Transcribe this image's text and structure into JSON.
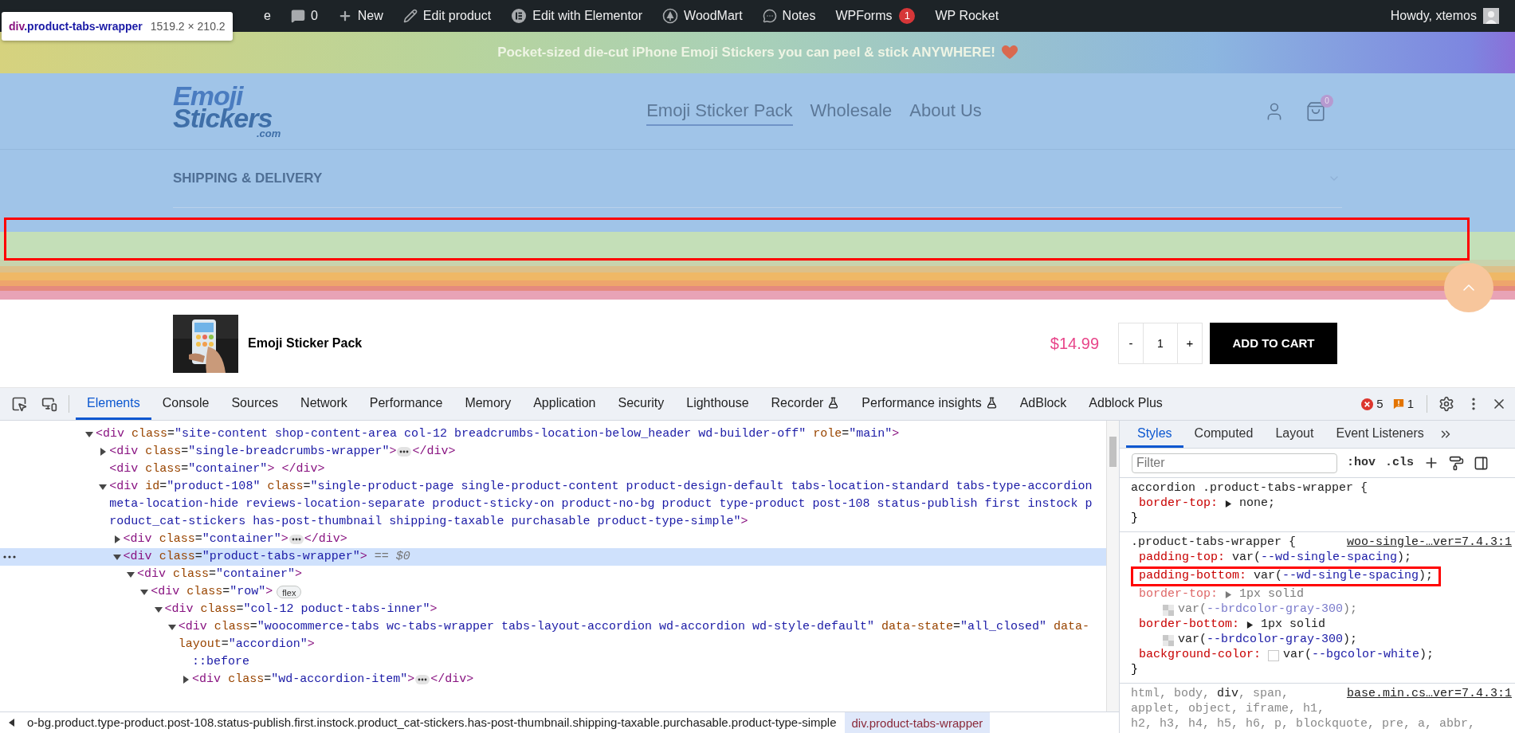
{
  "admin_bar": {
    "items": [
      {
        "kind": "plain",
        "label": "e"
      },
      {
        "kind": "comments",
        "label": "0"
      },
      {
        "kind": "new",
        "label": "New"
      },
      {
        "kind": "edit",
        "label": "Edit product"
      },
      {
        "kind": "elementor",
        "label": "Edit with Elementor"
      },
      {
        "kind": "woodmart",
        "label": "WoodMart"
      },
      {
        "kind": "notes",
        "label": "Notes"
      },
      {
        "kind": "plain",
        "label": "WPForms",
        "badge": "1"
      },
      {
        "kind": "plain",
        "label": "WP Rocket"
      }
    ],
    "greeting": "Howdy, xtemos"
  },
  "inspect_tooltip": {
    "tag": "div",
    "selector": ".product-tabs-wrapper",
    "size": "1519.2 × 210.2"
  },
  "announcement": {
    "text": "Pocket-sized die-cut iPhone Emoji Stickers you can peel & stick ANYWHERE!"
  },
  "header": {
    "logo": {
      "line1": "Emoji",
      "line2": "Stickers",
      "line3": ".com"
    },
    "nav": [
      {
        "label": "Emoji Sticker Pack",
        "selected": true
      },
      {
        "label": "Wholesale",
        "selected": false
      },
      {
        "label": "About Us",
        "selected": false
      }
    ],
    "cart_count": "0"
  },
  "accordion": {
    "title": "SHIPPING & DELIVERY",
    "expanded": false
  },
  "highlight": {
    "outlined": true
  },
  "sticky_bar": {
    "product_name": "Emoji Sticker Pack",
    "price": "$14.99",
    "minus": "-",
    "quantity": "1",
    "plus": "+",
    "button": "ADD TO CART"
  },
  "devtools": {
    "tabs": [
      {
        "label": "Elements",
        "selected": true,
        "flask": false
      },
      {
        "label": "Console",
        "selected": false,
        "flask": false
      },
      {
        "label": "Sources",
        "selected": false,
        "flask": false
      },
      {
        "label": "Network",
        "selected": false,
        "flask": false
      },
      {
        "label": "Performance",
        "selected": false,
        "flask": false
      },
      {
        "label": "Memory",
        "selected": false,
        "flask": false
      },
      {
        "label": "Application",
        "selected": false,
        "flask": false
      },
      {
        "label": "Security",
        "selected": false,
        "flask": false
      },
      {
        "label": "Lighthouse",
        "selected": false,
        "flask": false
      },
      {
        "label": "Recorder",
        "selected": false,
        "flask": true
      },
      {
        "label": "Performance insights",
        "selected": false,
        "flask": true
      },
      {
        "label": "AdBlock",
        "selected": false,
        "flask": false
      },
      {
        "label": "Adblock Plus",
        "selected": false,
        "flask": false
      }
    ],
    "errors": "5",
    "warnings": "1",
    "dom_tree": [
      {
        "kind": "element",
        "expanded": true,
        "selected": false,
        "lines": [
          "<div class=\"site-content shop-content-area col-12 breadcrumbs-location-below_header wd-builder-off\" role=\"main\">"
        ],
        "children": [
          {
            "kind": "element",
            "expanded": false,
            "selected": false,
            "lines": [
              "<div class=\"single-breadcrumbs-wrapper\">"
            ],
            "close": "</div>"
          },
          {
            "kind": "leaf",
            "selected": false,
            "lines": [
              "<div class=\"container\"> </div>"
            ]
          },
          {
            "kind": "element",
            "expanded": true,
            "selected": false,
            "lines": [
              "<div id=\"product-108\" class=\"single-product-page single-product-content product-design-default tabs-location-standard tabs-type-accordion ",
              "meta-location-hide reviews-location-separate product-sticky-on product-no-bg product type-product post-108 status-publish first instock p",
              "roduct_cat-stickers has-post-thumbnail shipping-taxable purchasable product-type-simple\">"
            ],
            "children": [
              {
                "kind": "element",
                "expanded": false,
                "selected": false,
                "lines": [
                  "<div class=\"container\">"
                ],
                "close": "</div>"
              },
              {
                "kind": "element",
                "expanded": true,
                "selected": true,
                "suffix": "== $0",
                "lines": [
                  "<div class=\"product-tabs-wrapper\">"
                ],
                "children": [
                  {
                    "kind": "element",
                    "expanded": true,
                    "selected": false,
                    "lines": [
                      "<div class=\"container\">"
                    ],
                    "children": [
                      {
                        "kind": "element",
                        "expanded": true,
                        "selected": false,
                        "badge": "flex",
                        "lines": [
                          "<div class=\"row\">"
                        ],
                        "children": [
                          {
                            "kind": "element",
                            "expanded": true,
                            "selected": false,
                            "lines": [
                              "<div class=\"col-12 poduct-tabs-inner\">"
                            ],
                            "children": [
                              {
                                "kind": "element",
                                "expanded": true,
                                "selected": false,
                                "lines": [
                                  "<div class=\"woocommerce-tabs wc-tabs-wrapper tabs-layout-accordion wd-accordion wd-style-default\" data-state=\"all_closed\" data-",
                                  "layout=\"accordion\">"
                                ],
                                "children": [
                                  {
                                    "kind": "pseudo",
                                    "selected": false,
                                    "lines": [
                                      "::before"
                                    ]
                                  },
                                  {
                                    "kind": "element",
                                    "expanded": false,
                                    "selected": false,
                                    "lines": [
                                      "<div class=\"wd-accordion-item\">"
                                    ],
                                    "close": "</div>"
                                  }
                                ]
                              }
                            ]
                          }
                        ]
                      }
                    ]
                  }
                ]
              }
            ]
          }
        ]
      }
    ],
    "breadcrumbs": [
      {
        "text": "o-bg.product.type-product.post-108.status-publish.first.instock.product_cat-stickers.has-post-thumbnail.shipping-taxable.purchasable.product-type-simple",
        "selected": false
      },
      {
        "text": "div.product-tabs-wrapper",
        "selected": true
      }
    ],
    "sidebar_tabs": [
      {
        "label": "Styles",
        "selected": true
      },
      {
        "label": "Computed",
        "selected": false
      },
      {
        "label": "Layout",
        "selected": false
      },
      {
        "label": "Event Listeners",
        "selected": false
      }
    ],
    "filter": {
      "placeholder": "Filter"
    },
    "hov": ":hov",
    "cls": ".cls",
    "rules": [
      {
        "selector_lines": [
          [
            {
              "text": "accordion .product-tabs-wrapper {",
              "matched": true
            }
          ]
        ],
        "declarations": [
          {
            "property": "border-top:",
            "expandable": true,
            "overridden": false,
            "highlighted": false,
            "value_lines": [
              {
                "text": "none;",
                "kind": "plain"
              }
            ]
          }
        ],
        "close": "}"
      },
      {
        "selector_lines": [
          [
            {
              "text": ".product-tabs-wrapper {",
              "matched": true
            }
          ]
        ],
        "source": "woo-single-…ver=7.4.3:1",
        "declarations": [
          {
            "property": "padding-top:",
            "expandable": false,
            "overridden": false,
            "highlighted": false,
            "value_lines": [
              {
                "text": "var(--wd-single-spacing);",
                "kind": "plain"
              }
            ]
          },
          {
            "property": "padding-bottom:",
            "expandable": false,
            "overridden": false,
            "highlighted": true,
            "value_lines": [
              {
                "text": "var(--wd-single-spacing);",
                "kind": "plain"
              }
            ]
          },
          {
            "property": "border-top:",
            "expandable": true,
            "overridden": true,
            "highlighted": false,
            "value_lines": [
              {
                "text": "1px solid",
                "kind": "plain"
              },
              {
                "text": "var(--brdcolor-gray-300);",
                "kind": "checker"
              }
            ]
          },
          {
            "property": "border-bottom:",
            "expandable": true,
            "overridden": false,
            "highlighted": false,
            "value_lines": [
              {
                "text": "1px solid",
                "kind": "plain"
              },
              {
                "text": "var(--brdcolor-gray-300);",
                "kind": "checker"
              }
            ]
          },
          {
            "property": "background-color:",
            "expandable": false,
            "overridden": false,
            "highlighted": false,
            "value_lines": [
              {
                "text": "var(--bgcolor-white);",
                "kind": "white"
              }
            ]
          }
        ],
        "close": "}"
      },
      {
        "selector_lines": [
          [
            {
              "text": "html, body, ",
              "matched": false
            },
            {
              "text": "div",
              "matched": true
            },
            {
              "text": ", span,",
              "matched": false
            }
          ],
          [
            {
              "text": "applet, object, iframe, h1,",
              "matched": false
            }
          ],
          [
            {
              "text": "h2, h3, h4, h5, h6, p, blockquote, pre, a, abbr,",
              "matched": false
            }
          ]
        ],
        "source": "base.min.cs…ver=7.4.3:1"
      }
    ]
  }
}
